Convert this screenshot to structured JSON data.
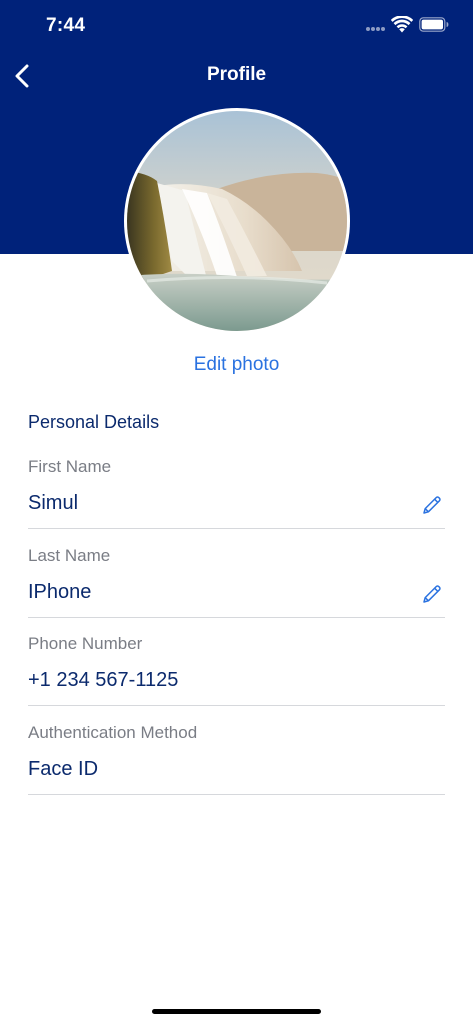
{
  "status_bar": {
    "time": "7:44",
    "icons": [
      "signal-dots-icon",
      "wifi-icon",
      "battery-icon"
    ]
  },
  "nav": {
    "title": "Profile",
    "back_icon": "chevron-left-icon"
  },
  "profile": {
    "avatar_icon": "waterfall-photo",
    "edit_photo_label": "Edit photo"
  },
  "personal_details": {
    "section_title": "Personal Details",
    "fields": [
      {
        "label": "First Name",
        "value": "Simul",
        "editable": true,
        "edit_icon": "pencil-icon"
      },
      {
        "label": "Last Name",
        "value": "IPhone",
        "editable": true,
        "edit_icon": "pencil-icon"
      },
      {
        "label": "Phone Number",
        "value": "+1 234 567-1125",
        "editable": false
      },
      {
        "label": "Authentication Method",
        "value": "Face ID",
        "editable": false
      }
    ]
  },
  "colors": {
    "header_background": "#00227a",
    "accent": "#2a72e0",
    "value_text": "#0b2a6d",
    "label_text": "#7a7d85",
    "divider": "#d6d8dc"
  }
}
